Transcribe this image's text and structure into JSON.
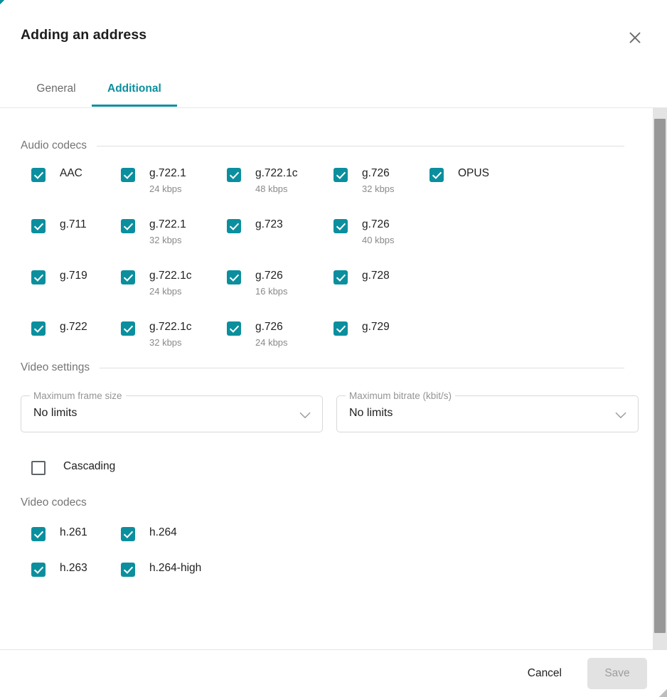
{
  "dialog": {
    "title": "Adding an address",
    "close_icon": "close-icon"
  },
  "tabs": [
    {
      "label": "General",
      "active": false
    },
    {
      "label": "Additional",
      "active": true
    }
  ],
  "sections": {
    "audio": {
      "title": "Audio codecs",
      "has_rule": true,
      "items": [
        {
          "label": "AAC",
          "sub": "",
          "checked": true,
          "col": 0,
          "row": 0
        },
        {
          "label": "g.722.1",
          "sub": "24 kbps",
          "checked": true,
          "col": 1,
          "row": 0
        },
        {
          "label": "g.722.1c",
          "sub": "48 kbps",
          "checked": true,
          "col": 2,
          "row": 0
        },
        {
          "label": "g.726",
          "sub": "32 kbps",
          "checked": true,
          "col": 3,
          "row": 0
        },
        {
          "label": "OPUS",
          "sub": "",
          "checked": true,
          "col": 4,
          "row": 0
        },
        {
          "label": "g.711",
          "sub": "",
          "checked": true,
          "col": 0,
          "row": 1
        },
        {
          "label": "g.722.1",
          "sub": "32 kbps",
          "checked": true,
          "col": 1,
          "row": 1
        },
        {
          "label": "g.723",
          "sub": "",
          "checked": true,
          "col": 2,
          "row": 1
        },
        {
          "label": "g.726",
          "sub": "40 kbps",
          "checked": true,
          "col": 3,
          "row": 1
        },
        {
          "label": "g.719",
          "sub": "",
          "checked": true,
          "col": 0,
          "row": 2
        },
        {
          "label": "g.722.1c",
          "sub": "24 kbps",
          "checked": true,
          "col": 1,
          "row": 2
        },
        {
          "label": "g.726",
          "sub": "16 kbps",
          "checked": true,
          "col": 2,
          "row": 2
        },
        {
          "label": "g.728",
          "sub": "",
          "checked": true,
          "col": 3,
          "row": 2
        },
        {
          "label": "g.722",
          "sub": "",
          "checked": true,
          "col": 0,
          "row": 3
        },
        {
          "label": "g.722.1c",
          "sub": "32 kbps",
          "checked": true,
          "col": 1,
          "row": 3
        },
        {
          "label": "g.726",
          "sub": "24 kbps",
          "checked": true,
          "col": 2,
          "row": 3
        },
        {
          "label": "g.729",
          "sub": "",
          "checked": true,
          "col": 3,
          "row": 3
        }
      ]
    },
    "video_settings": {
      "title": "Video settings",
      "has_rule": true,
      "selects": [
        {
          "legend": "Maximum frame size",
          "value": "No limits",
          "chevron": "chevron-down-icon"
        },
        {
          "legend": "Maximum bitrate (kbit/s)",
          "value": "No limits",
          "chevron": "chevron-down-icon"
        }
      ],
      "cascading": {
        "label": "Cascading",
        "checked": false
      }
    },
    "video_codecs": {
      "title": "Video codecs",
      "has_rule": false,
      "items": [
        {
          "label": "h.261",
          "sub": "",
          "checked": true,
          "col": 0,
          "row": 0
        },
        {
          "label": "h.264",
          "sub": "",
          "checked": true,
          "col": 1,
          "row": 0
        },
        {
          "label": "h.263",
          "sub": "",
          "checked": true,
          "col": 0,
          "row": 1
        },
        {
          "label": "h.264-high",
          "sub": "",
          "checked": true,
          "col": 1,
          "row": 1
        }
      ]
    }
  },
  "footer": {
    "cancel_label": "Cancel",
    "save_label": "Save"
  },
  "colors": {
    "accent": "#0b8f9e",
    "text": "#212121",
    "muted": "#8a8a8a",
    "scrollbar_thumb": "#989898",
    "scrollbar_track": "#e4e4e4"
  }
}
